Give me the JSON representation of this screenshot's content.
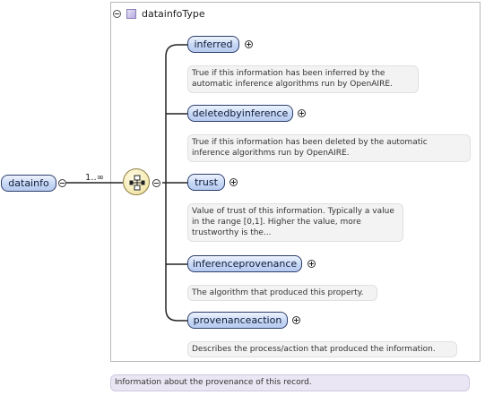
{
  "type_box": {
    "name": "datainfoType"
  },
  "root": {
    "label": "datainfo",
    "cardinality": "1..∞",
    "description": "Information about the provenance of this record."
  },
  "children": [
    {
      "label": "inferred",
      "description": "True if this information has been inferred by the automatic inference algorithms run by OpenAIRE."
    },
    {
      "label": "deletedbyinference",
      "description": "True if this information has been deleted by the automatic inference algorithms run by OpenAIRE."
    },
    {
      "label": "trust",
      "description": "Value of trust of this information. Typically a value in the range [0,1]. Higher the value, more trustworthy is the..."
    },
    {
      "label": "inferenceprovenance",
      "description": "The algorithm that produced this property."
    },
    {
      "label": "provenanceaction",
      "description": "Describes the process/action that produced the information."
    }
  ],
  "icons": {
    "type": "complex-type-icon",
    "compositor": "sequence-compositor-icon"
  }
}
